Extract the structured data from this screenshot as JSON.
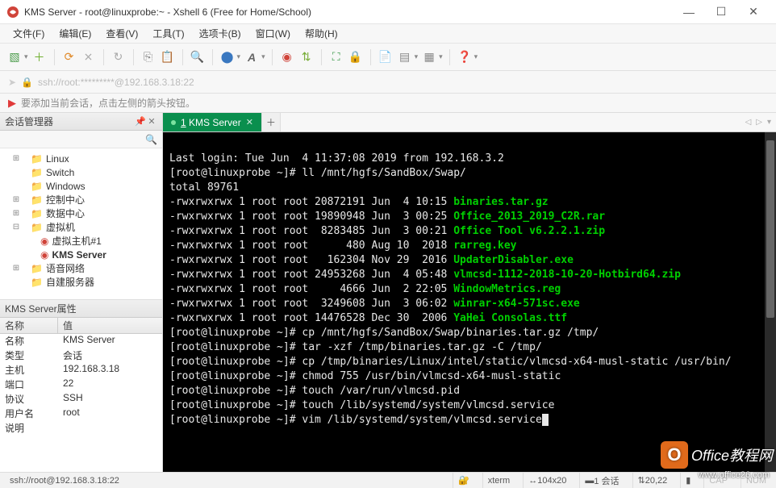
{
  "window": {
    "title": "KMS Server - root@linuxprobe:~ - Xshell 6 (Free for Home/School)"
  },
  "menu": [
    "文件(F)",
    "编辑(E)",
    "查看(V)",
    "工具(T)",
    "选项卡(B)",
    "窗口(W)",
    "帮助(H)"
  ],
  "address": "ssh://root:*********@192.168.3.18:22",
  "hint": "要添加当前会话，点击左侧的箭头按钮。",
  "session_panel": {
    "title": "会话管理器",
    "tree": [
      {
        "depth": 0,
        "tw": "+",
        "icon": "folder",
        "label": "Linux"
      },
      {
        "depth": 0,
        "tw": "",
        "icon": "folder",
        "label": "Switch"
      },
      {
        "depth": 0,
        "tw": "",
        "icon": "folder",
        "label": "Windows"
      },
      {
        "depth": 0,
        "tw": "+",
        "icon": "folder",
        "label": "控制中心"
      },
      {
        "depth": 0,
        "tw": "+",
        "icon": "folder",
        "label": "数据中心"
      },
      {
        "depth": 0,
        "tw": "-",
        "icon": "folder",
        "label": "虚拟机"
      },
      {
        "depth": 1,
        "tw": "",
        "icon": "globe",
        "label": "虚拟主机#1"
      },
      {
        "depth": 1,
        "tw": "",
        "icon": "globe",
        "label": "KMS Server",
        "selected": true
      },
      {
        "depth": 0,
        "tw": "+",
        "icon": "folder",
        "label": "语音网络"
      },
      {
        "depth": 0,
        "tw": "",
        "icon": "folder",
        "label": "自建服务器"
      }
    ]
  },
  "props_panel": {
    "title": "KMS Server属性",
    "head_name": "名称",
    "head_value": "值",
    "rows": [
      {
        "k": "名称",
        "v": "KMS Server"
      },
      {
        "k": "类型",
        "v": "会话"
      },
      {
        "k": "主机",
        "v": "192.168.3.18"
      },
      {
        "k": "端口",
        "v": "22"
      },
      {
        "k": "协议",
        "v": "SSH"
      },
      {
        "k": "用户名",
        "v": "root"
      },
      {
        "k": "说明",
        "v": ""
      }
    ]
  },
  "tab": {
    "index": "1",
    "label": "KMS Server"
  },
  "terminal": {
    "lines": [
      {
        "t": ""
      },
      {
        "t": "Last login: Tue Jun  4 11:37:08 2019 from 192.168.3.2"
      },
      {
        "p": "[root@linuxprobe ~]# ",
        "t": "ll /mnt/hgfs/SandBox/Swap/"
      },
      {
        "t": "total 89761"
      },
      {
        "t": "-rwxrwxrwx 1 root root 20872191 Jun  4 10:15 ",
        "g": "binaries.tar.gz"
      },
      {
        "t": "-rwxrwxrwx 1 root root 19890948 Jun  3 00:25 ",
        "g": "Office_2013_2019_C2R.rar"
      },
      {
        "t": "-rwxrwxrwx 1 root root  8283485 Jun  3 00:21 ",
        "g": "Office Tool v6.2.2.1.zip"
      },
      {
        "t": "-rwxrwxrwx 1 root root      480 Aug 10  2018 ",
        "g": "rarreg.key"
      },
      {
        "t": "-rwxrwxrwx 1 root root   162304 Nov 29  2016 ",
        "g": "UpdaterDisabler.exe"
      },
      {
        "t": "-rwxrwxrwx 1 root root 24953268 Jun  4 05:48 ",
        "g": "vlmcsd-1112-2018-10-20-Hotbird64.zip"
      },
      {
        "t": "-rwxrwxrwx 1 root root     4666 Jun  2 22:05 ",
        "g": "WindowMetrics.reg"
      },
      {
        "t": "-rwxrwxrwx 1 root root  3249608 Jun  3 06:02 ",
        "g": "winrar-x64-571sc.exe"
      },
      {
        "t": "-rwxrwxrwx 1 root root 14476528 Dec 30  2006 ",
        "g": "YaHei Consolas.ttf"
      },
      {
        "p": "[root@linuxprobe ~]# ",
        "t": "cp /mnt/hgfs/SandBox/Swap/binaries.tar.gz /tmp/"
      },
      {
        "p": "[root@linuxprobe ~]# ",
        "t": "tar -xzf /tmp/binaries.tar.gz -C /tmp/"
      },
      {
        "p": "[root@linuxprobe ~]# ",
        "t": "cp /tmp/binaries/Linux/intel/static/vlmcsd-x64-musl-static /usr/bin/"
      },
      {
        "p": "[root@linuxprobe ~]# ",
        "t": "chmod 755 /usr/bin/vlmcsd-x64-musl-static"
      },
      {
        "p": "[root@linuxprobe ~]# ",
        "t": "touch /var/run/vlmcsd.pid"
      },
      {
        "p": "[root@linuxprobe ~]# ",
        "t": "touch /lib/systemd/system/vlmcsd.service"
      },
      {
        "p": "[root@linuxprobe ~]# ",
        "t": "vim /lib/systemd/system/vlmcsd.service",
        "cursor": true
      }
    ]
  },
  "status": {
    "left": "ssh://root@192.168.3.18:22",
    "encoding": "xterm",
    "size": "104x20",
    "sessions": "1 会话",
    "pos": "20,22",
    "cap": "CAP",
    "num": "NUM"
  },
  "watermark": {
    "brand": "Office教程网",
    "url": "www.office26.com"
  }
}
